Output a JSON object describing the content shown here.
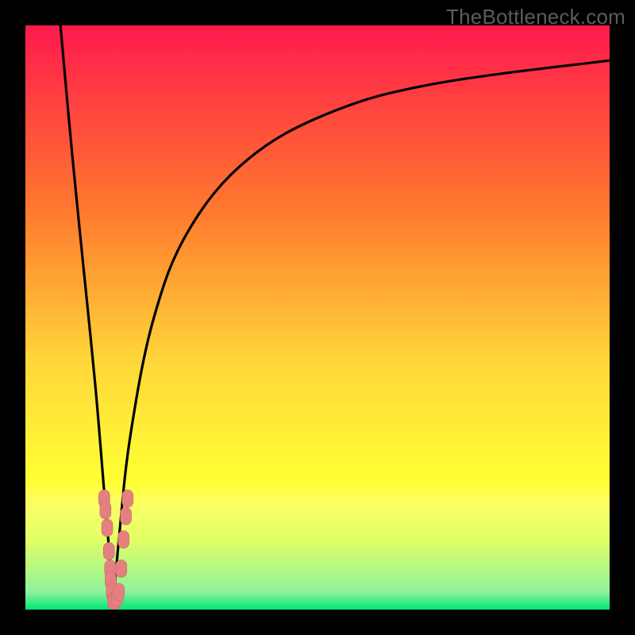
{
  "watermark": "TheBottleneck.com",
  "colors": {
    "frame": "#000000",
    "grad_top": "#ff1a4d",
    "grad_mid1": "#ff7a2e",
    "grad_mid2": "#ffd83a",
    "grad_mid3": "#ffff33",
    "grad_mid4": "#e2ff66",
    "grad_bottom": "#00e676",
    "curve": "#000000",
    "marker_fill": "#e58080",
    "marker_stroke": "#c96b6b"
  },
  "chart_data": {
    "type": "line",
    "title": "",
    "xlabel": "",
    "ylabel": "",
    "xlim": [
      0,
      100
    ],
    "ylim": [
      0,
      100
    ],
    "curve": {
      "type": "bottleneck-v",
      "minimum_x": 15,
      "left_branch": [
        {
          "x": 6,
          "y": 100
        },
        {
          "x": 8,
          "y": 78
        },
        {
          "x": 10,
          "y": 58
        },
        {
          "x": 12,
          "y": 38
        },
        {
          "x": 13.5,
          "y": 20
        },
        {
          "x": 14.5,
          "y": 8
        },
        {
          "x": 15,
          "y": 0
        }
      ],
      "right_branch": [
        {
          "x": 15,
          "y": 0
        },
        {
          "x": 16,
          "y": 12
        },
        {
          "x": 18,
          "y": 30
        },
        {
          "x": 22,
          "y": 50
        },
        {
          "x": 28,
          "y": 65
        },
        {
          "x": 38,
          "y": 77
        },
        {
          "x": 52,
          "y": 85
        },
        {
          "x": 70,
          "y": 90
        },
        {
          "x": 100,
          "y": 94
        }
      ]
    },
    "markers": [
      {
        "x": 13.5,
        "y": 19
      },
      {
        "x": 13.7,
        "y": 17
      },
      {
        "x": 14.0,
        "y": 14
      },
      {
        "x": 14.3,
        "y": 10
      },
      {
        "x": 14.5,
        "y": 7
      },
      {
        "x": 14.6,
        "y": 5
      },
      {
        "x": 14.8,
        "y": 3
      },
      {
        "x": 15.0,
        "y": 1.5
      },
      {
        "x": 15.3,
        "y": 1.5
      },
      {
        "x": 15.7,
        "y": 2.0
      },
      {
        "x": 16.0,
        "y": 3.0
      },
      {
        "x": 16.4,
        "y": 7
      },
      {
        "x": 16.8,
        "y": 12
      },
      {
        "x": 17.2,
        "y": 16
      },
      {
        "x": 17.5,
        "y": 19
      }
    ]
  }
}
